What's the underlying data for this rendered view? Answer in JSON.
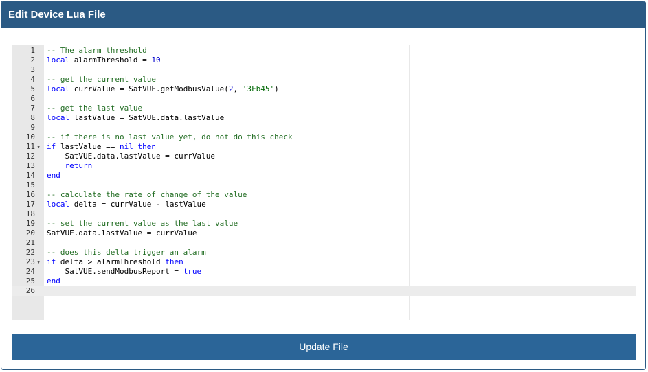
{
  "panel": {
    "title": "Edit Device Lua File"
  },
  "editor": {
    "active_line": 26,
    "lines": [
      {
        "num": "1",
        "fold": false,
        "tokens": [
          {
            "t": "-- The alarm threshold",
            "c": "c"
          }
        ]
      },
      {
        "num": "2",
        "fold": false,
        "tokens": [
          {
            "t": "local",
            "c": "k"
          },
          {
            "t": " alarmThreshold = ",
            "c": ""
          },
          {
            "t": "10",
            "c": "n"
          }
        ]
      },
      {
        "num": "3",
        "fold": false,
        "tokens": []
      },
      {
        "num": "4",
        "fold": false,
        "tokens": [
          {
            "t": "-- get the current value",
            "c": "c"
          }
        ]
      },
      {
        "num": "5",
        "fold": false,
        "tokens": [
          {
            "t": "local",
            "c": "k"
          },
          {
            "t": " currValue = SatVUE.getModbusValue(",
            "c": ""
          },
          {
            "t": "2",
            "c": "n"
          },
          {
            "t": ", ",
            "c": ""
          },
          {
            "t": "'3Fb45'",
            "c": "s"
          },
          {
            "t": ")",
            "c": ""
          }
        ]
      },
      {
        "num": "6",
        "fold": false,
        "tokens": []
      },
      {
        "num": "7",
        "fold": false,
        "tokens": [
          {
            "t": "-- get the last value",
            "c": "c"
          }
        ]
      },
      {
        "num": "8",
        "fold": false,
        "tokens": [
          {
            "t": "local",
            "c": "k"
          },
          {
            "t": " lastValue = SatVUE.data.lastValue",
            "c": ""
          }
        ]
      },
      {
        "num": "9",
        "fold": false,
        "tokens": []
      },
      {
        "num": "10",
        "fold": false,
        "tokens": [
          {
            "t": "-- if there is no last value yet, do not do this check",
            "c": "c"
          }
        ]
      },
      {
        "num": "11",
        "fold": true,
        "tokens": [
          {
            "t": "if",
            "c": "k"
          },
          {
            "t": " lastValue == ",
            "c": ""
          },
          {
            "t": "nil",
            "c": "k"
          },
          {
            "t": " ",
            "c": ""
          },
          {
            "t": "then",
            "c": "k"
          }
        ]
      },
      {
        "num": "12",
        "fold": false,
        "tokens": [
          {
            "t": "    SatVUE.data.lastValue = currValue",
            "c": ""
          }
        ]
      },
      {
        "num": "13",
        "fold": false,
        "tokens": [
          {
            "t": "    ",
            "c": ""
          },
          {
            "t": "return",
            "c": "k"
          }
        ]
      },
      {
        "num": "14",
        "fold": false,
        "tokens": [
          {
            "t": "end",
            "c": "k"
          }
        ]
      },
      {
        "num": "15",
        "fold": false,
        "tokens": []
      },
      {
        "num": "16",
        "fold": false,
        "tokens": [
          {
            "t": "-- calculate the rate of change of the value",
            "c": "c"
          }
        ]
      },
      {
        "num": "17",
        "fold": false,
        "tokens": [
          {
            "t": "local",
            "c": "k"
          },
          {
            "t": " delta = currValue - lastValue",
            "c": ""
          }
        ]
      },
      {
        "num": "18",
        "fold": false,
        "tokens": []
      },
      {
        "num": "19",
        "fold": false,
        "tokens": [
          {
            "t": "-- set the current value as the last value",
            "c": "c"
          }
        ]
      },
      {
        "num": "20",
        "fold": false,
        "tokens": [
          {
            "t": "SatVUE.data.lastValue = currValue",
            "c": ""
          }
        ]
      },
      {
        "num": "21",
        "fold": false,
        "tokens": []
      },
      {
        "num": "22",
        "fold": false,
        "tokens": [
          {
            "t": "-- does this delta trigger an alarm",
            "c": "c"
          }
        ]
      },
      {
        "num": "23",
        "fold": true,
        "tokens": [
          {
            "t": "if",
            "c": "k"
          },
          {
            "t": " delta > alarmThreshold ",
            "c": ""
          },
          {
            "t": "then",
            "c": "k"
          }
        ]
      },
      {
        "num": "24",
        "fold": false,
        "tokens": [
          {
            "t": "    SatVUE.sendModbusReport = ",
            "c": ""
          },
          {
            "t": "true",
            "c": "k"
          }
        ]
      },
      {
        "num": "25",
        "fold": false,
        "tokens": [
          {
            "t": "end",
            "c": "k"
          }
        ]
      },
      {
        "num": "26",
        "fold": false,
        "tokens": []
      }
    ]
  },
  "actions": {
    "update_label": "Update File"
  }
}
